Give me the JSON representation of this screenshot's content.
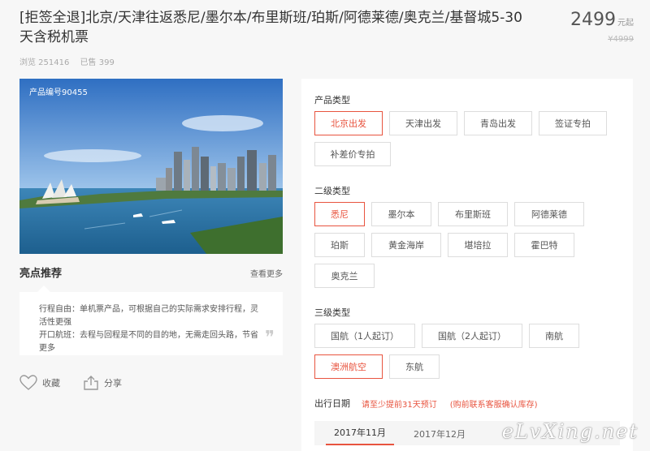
{
  "product": {
    "title": "[拒签全退]北京/天津往返悉尼/墨尔本/布里斯班/珀斯/阿德莱德/奥克兰/基督城5-30天含税机票",
    "views": "浏览 251416",
    "sold": "已售 399",
    "price": "2499",
    "price_unit": "元起",
    "old_price": "¥4999",
    "code": "产品编号90455"
  },
  "highlights": {
    "title": "亮点推荐",
    "more": "查看更多",
    "lines": [
      "行程自由：单机票产品，可根据自己的实际需求安排行程，灵活性更强",
      "开口航班：去程与回程是不同的目的地，无需走回头路，节省更多"
    ],
    "quote": "❞"
  },
  "social": {
    "favorite": "收藏",
    "share": "分享"
  },
  "options": {
    "type": {
      "label": "产品类型",
      "items": [
        {
          "text": "北京出发",
          "selected": true
        },
        {
          "text": "天津出发",
          "selected": false
        },
        {
          "text": "青岛出发",
          "selected": false
        },
        {
          "text": "签证专拍",
          "selected": false
        },
        {
          "text": "补差价专拍",
          "selected": false
        }
      ]
    },
    "level2": {
      "label": "二级类型",
      "items": [
        {
          "text": "悉尼",
          "selected": true
        },
        {
          "text": "墨尔本",
          "selected": false
        },
        {
          "text": "布里斯班",
          "selected": false
        },
        {
          "text": "阿德莱德",
          "selected": false
        },
        {
          "text": "珀斯",
          "selected": false
        },
        {
          "text": "黄金海岸",
          "selected": false
        },
        {
          "text": "堪培拉",
          "selected": false
        },
        {
          "text": "霍巴特",
          "selected": false
        },
        {
          "text": "奥克兰",
          "selected": false
        }
      ]
    },
    "level3": {
      "label": "三级类型",
      "items": [
        {
          "text": "国航（1人起订）",
          "selected": false
        },
        {
          "text": "国航（2人起订）",
          "selected": false
        },
        {
          "text": "南航",
          "selected": false
        },
        {
          "text": "澳洲航空",
          "selected": true
        },
        {
          "text": "东航",
          "selected": false
        }
      ]
    }
  },
  "date": {
    "label": "出行日期",
    "note1": "请至少提前31天预订",
    "note2": "(购前联系客服确认库存)",
    "months": [
      {
        "text": "2017年11月",
        "active": true
      },
      {
        "text": "2017年12月",
        "active": false
      }
    ]
  },
  "watermark": "eLvXing.net",
  "colors": {
    "accent": "#e8543f"
  }
}
